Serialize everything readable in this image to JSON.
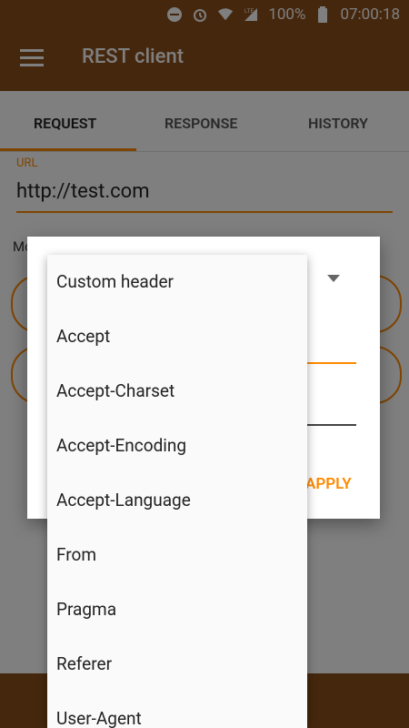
{
  "status": {
    "battery_percent": "100%",
    "time": "07:00:18",
    "network": "LTE"
  },
  "app": {
    "title": "REST client"
  },
  "tabs": [
    {
      "label": "REQUEST",
      "active": true
    },
    {
      "label": "RESPONSE",
      "active": false
    },
    {
      "label": "HISTORY",
      "active": false
    }
  ],
  "url": {
    "label": "URL",
    "value": "http://test.com"
  },
  "method": {
    "label": "Mo"
  },
  "dialog": {
    "apply_label": "APPLY"
  },
  "header_menu": {
    "items": [
      "Custom header",
      "Accept",
      "Accept-Charset",
      "Accept-Encoding",
      "Accept-Language",
      "From",
      "Pragma",
      "Referer",
      "User-Agent"
    ]
  },
  "colors": {
    "accent": "#ff8a00",
    "brand": "#8a4e1a"
  }
}
